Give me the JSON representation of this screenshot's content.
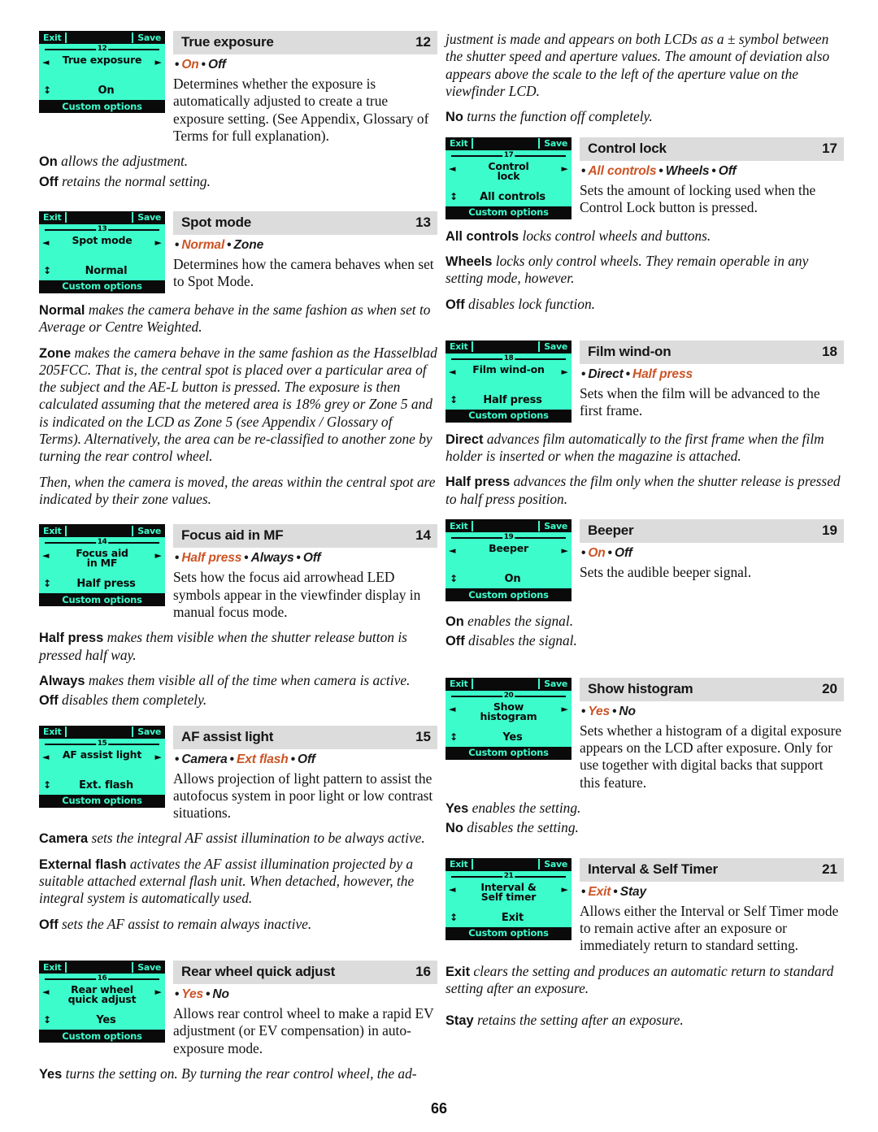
{
  "page": {
    "number": "66"
  },
  "colors": {
    "lcd_bg": "#3dfccb",
    "lcd_ink": "#0a0a0a",
    "header_bar": "#dcdcdc",
    "accent_selected": "#cc5324"
  },
  "lcd_chrome": {
    "exit": "Exit",
    "save": "Save",
    "footer": "Custom options",
    "arrow_left": "◄",
    "arrow_right": "►",
    "updown": "↕"
  },
  "left_column": {
    "entries": [
      {
        "lcd": {
          "num": "12",
          "title": "True exposure",
          "value": "On"
        },
        "header": {
          "title": "True exposure",
          "num": "12"
        },
        "options": [
          {
            "text": "On",
            "selected": true
          },
          {
            "text": "Off",
            "selected": false
          }
        ],
        "desc": "Determines whether the exposure is automatically adjusted to create a true exposure setting. (See Appendix, Glossary of Terms for full explanation)."
      },
      {
        "lcd": {
          "num": "13",
          "title": "Spot mode",
          "value": "Normal"
        },
        "header": {
          "title": "Spot mode",
          "num": "13"
        },
        "options": [
          {
            "text": "Normal",
            "selected": true
          },
          {
            "text": "Zone",
            "selected": false
          }
        ],
        "desc": "Determines how the camera behaves when set to Spot Mode."
      },
      {
        "lcd": {
          "num": "14",
          "title": "Focus aid\nin MF",
          "value": "Half press"
        },
        "header": {
          "title": "Focus aid in MF",
          "num": "14"
        },
        "options": [
          {
            "text": "Half press",
            "selected": true
          },
          {
            "text": "Always",
            "selected": false
          },
          {
            "text": "Off",
            "selected": false
          }
        ],
        "desc": "Sets how the focus aid arrowhead LED symbols appear in the viewfinder display in manual focus mode."
      },
      {
        "lcd": {
          "num": "15",
          "title": "AF assist light",
          "value": "Ext. flash"
        },
        "header": {
          "title": "AF assist light",
          "num": "15"
        },
        "options": [
          {
            "text": "Camera",
            "selected": false
          },
          {
            "text": "Ext flash",
            "selected": true
          },
          {
            "text": "Off",
            "selected": false
          }
        ],
        "desc": "Allows projection of light pattern to assist the autofocus system in poor light or low contrast situations."
      },
      {
        "lcd": {
          "num": "16",
          "title": "Rear wheel\nquick adjust",
          "value": "Yes"
        },
        "header": {
          "title": "Rear wheel quick adjust",
          "num": "16"
        },
        "options": [
          {
            "text": "Yes",
            "selected": true
          },
          {
            "text": "No",
            "selected": false
          }
        ],
        "desc": "Allows rear control wheel to make a rapid EV adjustment (or EV compensation) in auto-exposure mode."
      }
    ],
    "paras": {
      "true_exposure_on": {
        "term": "On",
        "rest": " allows the adjustment."
      },
      "true_exposure_off": {
        "term": "Off",
        "rest": " retains the normal setting."
      },
      "spot_normal": {
        "term": "Normal",
        "rest": " makes the camera behave in the same fashion as when set to Average or Centre Weighted."
      },
      "spot_zone": {
        "term": "Zone",
        "rest": " makes the camera behave in the same fashion as the Hasselblad 205FCC. That is, the central spot is placed over a particular area of the subject and the AE-L button is pressed. The exposure is then calculated assuming that the metered area is 18% grey or Zone 5 and is indicated on the LCD as Zone 5 (see Appendix / Glossary of Terms). Alternatively, the area can be re-classified to another zone by turning the rear control wheel."
      },
      "spot_then": {
        "term": "",
        "rest": "Then, when the camera is moved, the areas within the central spot are indicated by their zone values."
      },
      "focus_half": {
        "term": "Half press",
        "rest": " makes them visible when the shutter release button is pressed half way."
      },
      "focus_always": {
        "term": "Always",
        "rest": " makes them visible all of the time when camera is active."
      },
      "focus_off": {
        "term": "Off",
        "rest": " disables them completely."
      },
      "af_camera": {
        "term": "Camera",
        "rest": " sets the integral AF assist illumination to be always active."
      },
      "af_external": {
        "term": "External flash",
        "rest": " activates the AF assist illumination projected by a suitable attached external flash unit. When detached, however, the integral system is automatically used."
      },
      "af_off": {
        "term": "Off",
        "rest": " sets the AF assist to remain always inactive."
      },
      "rear_yes": {
        "term": "Yes",
        "rest": " turns the setting on. By turning the rear control wheel, the ad-"
      }
    }
  },
  "right_column": {
    "lead_para": "justment is made and appears on both LCDs as a ± symbol between the shutter speed and aperture values. The amount of deviation also appears above the scale to the left of the aperture value on the viewfinder LCD.",
    "lead_no": {
      "term": "No",
      "rest": " turns the function off completely."
    },
    "entries": [
      {
        "lcd": {
          "num": "17",
          "title": "Control\nlock",
          "value": "All controls"
        },
        "header": {
          "title": "Control lock",
          "num": "17"
        },
        "options": [
          {
            "text": "All controls",
            "selected": true
          },
          {
            "text": "Wheels",
            "selected": false
          },
          {
            "text": "Off",
            "selected": false
          }
        ],
        "desc": "Sets the amount of locking used when the Control Lock button is pressed."
      },
      {
        "lcd": {
          "num": "18",
          "title": "Film wind-on",
          "value": "Half press"
        },
        "header": {
          "title": "Film wind-on",
          "num": "18"
        },
        "options": [
          {
            "text": "Direct",
            "selected": false
          },
          {
            "text": "Half press",
            "selected": true
          }
        ],
        "desc": "Sets when the film will be advanced to the first frame."
      },
      {
        "lcd": {
          "num": "19",
          "title": "Beeper",
          "value": "On"
        },
        "header": {
          "title": "Beeper",
          "num": "19"
        },
        "options": [
          {
            "text": "On",
            "selected": true
          },
          {
            "text": "Off",
            "selected": false
          }
        ],
        "desc": "Sets the audible beeper signal."
      },
      {
        "lcd": {
          "num": "20",
          "title": "Show\nhistogram",
          "value": "Yes"
        },
        "header": {
          "title": "Show histogram",
          "num": "20"
        },
        "options": [
          {
            "text": "Yes",
            "selected": true
          },
          {
            "text": "No",
            "selected": false
          }
        ],
        "desc": "Sets whether a histogram of a digital exposure appears on the LCD after exposure. Only for use together with digital backs that support this feature."
      },
      {
        "lcd": {
          "num": "21",
          "title": "Interval &\nSelf timer",
          "value": "Exit"
        },
        "header": {
          "title": "Interval & Self Timer",
          "num": "21"
        },
        "options": [
          {
            "text": "Exit",
            "selected": true
          },
          {
            "text": "Stay",
            "selected": false
          }
        ],
        "desc": "Allows either the Interval or Self Timer mode to remain active after an exposure or immediately return to standard setting."
      }
    ],
    "paras": {
      "lock_all": {
        "term": "All controls",
        "rest": " locks control wheels and buttons."
      },
      "lock_wheels": {
        "term": "Wheels",
        "rest": " locks only control wheels. They remain operable in any setting mode, however."
      },
      "lock_off": {
        "term": "Off",
        "rest": " disables lock function."
      },
      "film_direct": {
        "term": "Direct",
        "rest": " advances film automatically to the first frame when the film holder is inserted or when the magazine is attached."
      },
      "film_half": {
        "term": "Half press",
        "rest": " advances the film only when the shutter release is pressed to half press position."
      },
      "beeper_on": {
        "term": "On",
        "rest": " enables the signal."
      },
      "beeper_off": {
        "term": "Off",
        "rest": " disables the signal."
      },
      "hist_yes": {
        "term": "Yes",
        "rest": " enables the setting."
      },
      "hist_no": {
        "term": "No",
        "rest": " disables the setting."
      },
      "timer_exit": {
        "term": "Exit",
        "rest": " clears the setting and produces an automatic return to standard setting after an exposure."
      },
      "timer_stay": {
        "term": "Stay",
        "rest": " retains the setting after an exposure."
      }
    }
  }
}
